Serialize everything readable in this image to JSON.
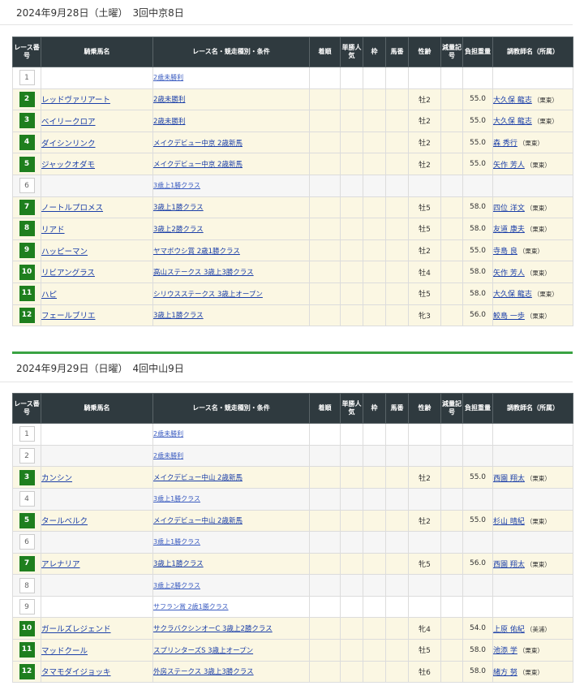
{
  "columns": [
    "レース番号",
    "騎乗馬名",
    "レース名・競走種別・条件",
    "着順",
    "単勝人気",
    "枠",
    "馬番",
    "性齢",
    "減量記号",
    "負担重量",
    "調教師名（所属）"
  ],
  "days": [
    {
      "date": "2024年9月28日（土曜）　3回中京8日",
      "races": [
        {
          "no": "1",
          "active": false,
          "horse": "",
          "race": "2歳未勝利",
          "rank": "",
          "pop": "",
          "waku": "",
          "uma": "",
          "sex": "",
          "gen": "",
          "weight": "",
          "trainer": "",
          "aff": ""
        },
        {
          "no": "2",
          "active": true,
          "horse": "レッドヴァリアート",
          "race": "2歳未勝利",
          "rank": "",
          "pop": "",
          "waku": "",
          "uma": "",
          "sex": "牡2",
          "gen": "",
          "weight": "55.0",
          "trainer": "大久保 龍志",
          "aff": "（栗東）"
        },
        {
          "no": "3",
          "active": true,
          "horse": "ベイリークロア",
          "race": "2歳未勝利",
          "rank": "",
          "pop": "",
          "waku": "",
          "uma": "",
          "sex": "牡2",
          "gen": "",
          "weight": "55.0",
          "trainer": "大久保 龍志",
          "aff": "（栗東）"
        },
        {
          "no": "4",
          "active": true,
          "horse": "ダイシンリンク",
          "race": "メイクデビュー中京 2歳新馬",
          "rank": "",
          "pop": "",
          "waku": "",
          "uma": "",
          "sex": "牡2",
          "gen": "",
          "weight": "55.0",
          "trainer": "森 秀行",
          "aff": "（栗東）"
        },
        {
          "no": "5",
          "active": true,
          "horse": "ジャックオダモ",
          "race": "メイクデビュー中京 2歳新馬",
          "rank": "",
          "pop": "",
          "waku": "",
          "uma": "",
          "sex": "牡2",
          "gen": "",
          "weight": "55.0",
          "trainer": "矢作 芳人",
          "aff": "（栗東）"
        },
        {
          "no": "6",
          "active": false,
          "horse": "",
          "race": "3歳上1勝クラス",
          "rank": "",
          "pop": "",
          "waku": "",
          "uma": "",
          "sex": "",
          "gen": "",
          "weight": "",
          "trainer": "",
          "aff": ""
        },
        {
          "no": "7",
          "active": true,
          "horse": "ノートルプロメス",
          "race": "3歳上1勝クラス",
          "rank": "",
          "pop": "",
          "waku": "",
          "uma": "",
          "sex": "牡5",
          "gen": "",
          "weight": "58.0",
          "trainer": "四位 洋文",
          "aff": "（栗東）"
        },
        {
          "no": "8",
          "active": true,
          "horse": "リアド",
          "race": "3歳上2勝クラス",
          "rank": "",
          "pop": "",
          "waku": "",
          "uma": "",
          "sex": "牡5",
          "gen": "",
          "weight": "58.0",
          "trainer": "友道 康夫",
          "aff": "（栗東）"
        },
        {
          "no": "9",
          "active": true,
          "horse": "ハッピーマン",
          "race": "ヤマボウシ賞 2歳1勝クラス",
          "rank": "",
          "pop": "",
          "waku": "",
          "uma": "",
          "sex": "牡2",
          "gen": "",
          "weight": "55.0",
          "trainer": "寺島 良",
          "aff": "（栗東）"
        },
        {
          "no": "10",
          "active": true,
          "horse": "リビアングラス",
          "race": "高山ステークス 3歳上3勝クラス",
          "rank": "",
          "pop": "",
          "waku": "",
          "uma": "",
          "sex": "牡4",
          "gen": "",
          "weight": "58.0",
          "trainer": "矢作 芳人",
          "aff": "（栗東）"
        },
        {
          "no": "11",
          "active": true,
          "horse": "ハピ",
          "race": "シリウスステークス 3歳上オープン",
          "rank": "",
          "pop": "",
          "waku": "",
          "uma": "",
          "sex": "牡5",
          "gen": "",
          "weight": "58.0",
          "trainer": "大久保 龍志",
          "aff": "（栗東）"
        },
        {
          "no": "12",
          "active": true,
          "horse": "フェールブリエ",
          "race": "3歳上1勝クラス",
          "rank": "",
          "pop": "",
          "waku": "",
          "uma": "",
          "sex": "牝3",
          "gen": "",
          "weight": "56.0",
          "trainer": "鮫島 一歩",
          "aff": "（栗東）"
        }
      ]
    },
    {
      "date": "2024年9月29日（日曜）　4回中山9日",
      "races": [
        {
          "no": "1",
          "active": false,
          "horse": "",
          "race": "2歳未勝利",
          "rank": "",
          "pop": "",
          "waku": "",
          "uma": "",
          "sex": "",
          "gen": "",
          "weight": "",
          "trainer": "",
          "aff": ""
        },
        {
          "no": "2",
          "active": false,
          "horse": "",
          "race": "2歳未勝利",
          "rank": "",
          "pop": "",
          "waku": "",
          "uma": "",
          "sex": "",
          "gen": "",
          "weight": "",
          "trainer": "",
          "aff": ""
        },
        {
          "no": "3",
          "active": true,
          "horse": "カンシン",
          "race": "メイクデビュー中山 2歳新馬",
          "rank": "",
          "pop": "",
          "waku": "",
          "uma": "",
          "sex": "牡2",
          "gen": "",
          "weight": "55.0",
          "trainer": "西園 翔太",
          "aff": "（栗東）"
        },
        {
          "no": "4",
          "active": false,
          "horse": "",
          "race": "3歳上1勝クラス",
          "rank": "",
          "pop": "",
          "waku": "",
          "uma": "",
          "sex": "",
          "gen": "",
          "weight": "",
          "trainer": "",
          "aff": ""
        },
        {
          "no": "5",
          "active": true,
          "horse": "タールベルク",
          "race": "メイクデビュー中山 2歳新馬",
          "rank": "",
          "pop": "",
          "waku": "",
          "uma": "",
          "sex": "牡2",
          "gen": "",
          "weight": "55.0",
          "trainer": "杉山 晴紀",
          "aff": "（栗東）"
        },
        {
          "no": "6",
          "active": false,
          "horse": "",
          "race": "3歳上1勝クラス",
          "rank": "",
          "pop": "",
          "waku": "",
          "uma": "",
          "sex": "",
          "gen": "",
          "weight": "",
          "trainer": "",
          "aff": ""
        },
        {
          "no": "7",
          "active": true,
          "horse": "アレナリア",
          "race": "3歳上1勝クラス",
          "rank": "",
          "pop": "",
          "waku": "",
          "uma": "",
          "sex": "牝5",
          "gen": "",
          "weight": "56.0",
          "trainer": "西園 翔太",
          "aff": "（栗東）"
        },
        {
          "no": "8",
          "active": false,
          "horse": "",
          "race": "3歳上2勝クラス",
          "rank": "",
          "pop": "",
          "waku": "",
          "uma": "",
          "sex": "",
          "gen": "",
          "weight": "",
          "trainer": "",
          "aff": ""
        },
        {
          "no": "9",
          "active": false,
          "horse": "",
          "race": "サフラン賞 2歳1勝クラス",
          "rank": "",
          "pop": "",
          "waku": "",
          "uma": "",
          "sex": "",
          "gen": "",
          "weight": "",
          "trainer": "",
          "aff": ""
        },
        {
          "no": "10",
          "active": true,
          "horse": "ガールズレジェンド",
          "race": "サクラバクシンオーC 3歳上2勝クラス",
          "rank": "",
          "pop": "",
          "waku": "",
          "uma": "",
          "sex": "牝4",
          "gen": "",
          "weight": "54.0",
          "trainer": "上原 佑紀",
          "aff": "（美浦）"
        },
        {
          "no": "11",
          "active": true,
          "horse": "マッドクール",
          "race": "スプリンターズS 3歳上オープン",
          "rank": "",
          "pop": "",
          "waku": "",
          "uma": "",
          "sex": "牡5",
          "gen": "",
          "weight": "58.0",
          "trainer": "池添 学",
          "aff": "（栗東）"
        },
        {
          "no": "12",
          "active": true,
          "horse": "タマモダイジョッキ",
          "race": "外房ステークス 3歳上3勝クラス",
          "rank": "",
          "pop": "",
          "waku": "",
          "uma": "",
          "sex": "牡6",
          "gen": "",
          "weight": "58.0",
          "trainer": "緒方 努",
          "aff": "（栗東）"
        }
      ]
    }
  ],
  "colors": {
    "accent_green": "#1e7f1e",
    "header_dark": "#2f3a3f",
    "row_active": "#fbf7e3",
    "link": "#1a3ea8",
    "divider": "#3aa343"
  }
}
